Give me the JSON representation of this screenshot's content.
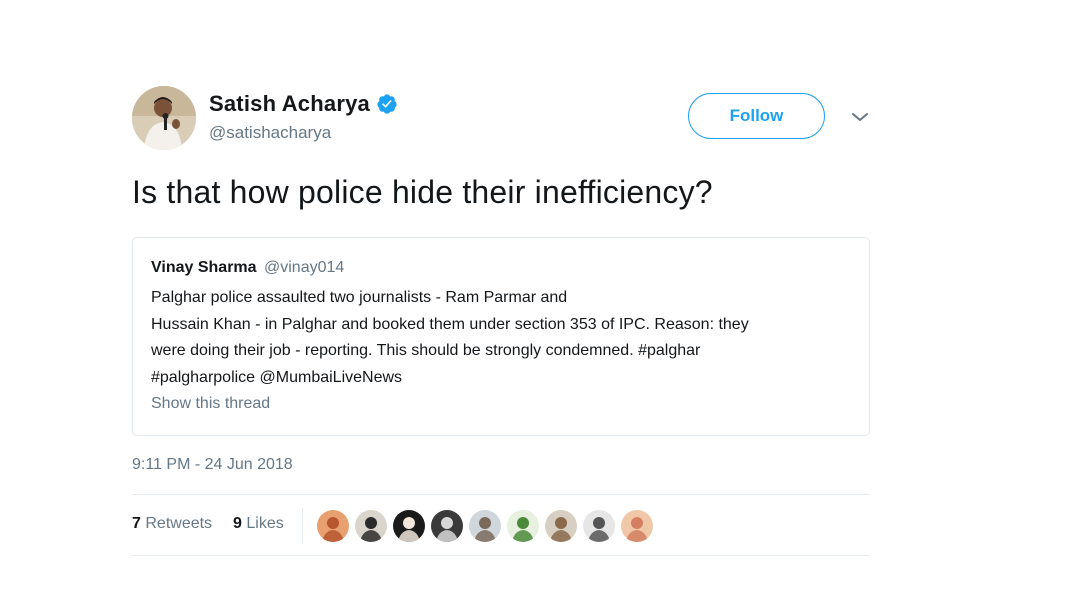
{
  "author": {
    "display_name": "Satish Acharya",
    "handle": "@satishacharya",
    "verified": true,
    "avatar_icon": "profile-photo"
  },
  "follow_button": {
    "label": "Follow"
  },
  "menu_icon": "chevron-down-icon",
  "tweet": {
    "text": "Is that how police hide their inefficiency?"
  },
  "quoted_tweet": {
    "author_name": "Vinay Sharma",
    "author_handle": "@vinay014",
    "text": "Palghar police assaulted two journalists - Ram Parmar and\nHussain Khan - in Palghar and booked them under section 353 of IPC. Reason: they\nwere doing their job - reporting. This should be strongly condemned. #palghar\n#palgharpolice @MumbaiLiveNews",
    "show_thread_label": "Show this thread"
  },
  "timestamp": "9:11 PM - 24 Jun 2018",
  "stats": {
    "retweets_count": "7",
    "retweets_label": "Retweets",
    "likes_count": "9",
    "likes_label": "Likes"
  },
  "liker_avatars": [
    {
      "bg": "#e8a070",
      "fg": "#b5562e"
    },
    {
      "bg": "#d9d4cc",
      "fg": "#2b2b2b"
    },
    {
      "bg": "#1a1a1a",
      "fg": "#f0e6dc"
    },
    {
      "bg": "#3a3a3a",
      "fg": "#d8d8d8"
    },
    {
      "bg": "#cfd6dc",
      "fg": "#7a6a5a"
    },
    {
      "bg": "#e8f0e0",
      "fg": "#4a8a3a"
    },
    {
      "bg": "#d6cfc2",
      "fg": "#8a6a4a"
    },
    {
      "bg": "#e6e6e6",
      "fg": "#555555"
    },
    {
      "bg": "#f0c8a8",
      "fg": "#d48060"
    }
  ],
  "colors": {
    "accent": "#1da1f2",
    "text": "#14171a",
    "secondary_text": "#657786",
    "border": "#e1e8ed"
  }
}
